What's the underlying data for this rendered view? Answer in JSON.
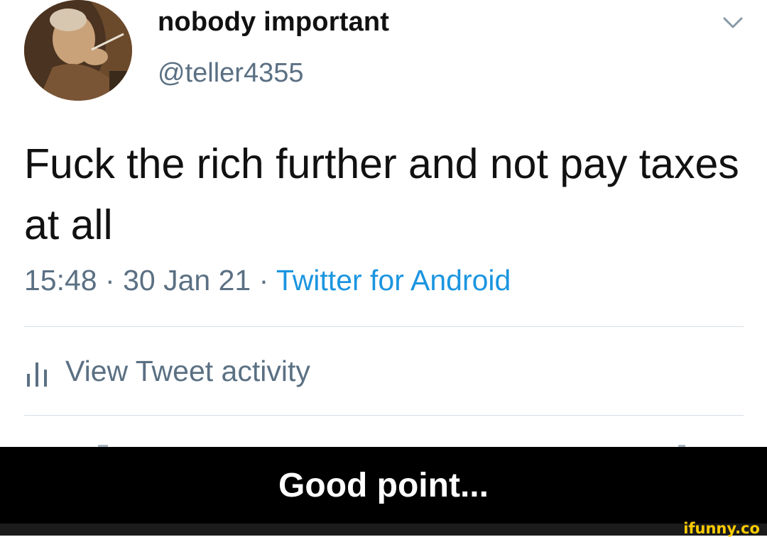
{
  "tweet": {
    "display_name": "nobody important",
    "handle": "@teller4355",
    "text": "Fuck the rich further and not pay taxes at all",
    "time": "15:48",
    "date": "30 Jan 21",
    "separator": "·",
    "source": "Twitter for Android",
    "activity_label": "View Tweet activity",
    "colors": {
      "link": "#1b95e0",
      "muted": "#5b7083",
      "text": "#111111"
    },
    "icons": {
      "menu": "chevron-down-icon",
      "activity": "bar-chart-icon"
    }
  },
  "caption": {
    "text": "Good point..."
  },
  "watermark": {
    "text": "ifunny.co",
    "color": "#ffcc00"
  }
}
